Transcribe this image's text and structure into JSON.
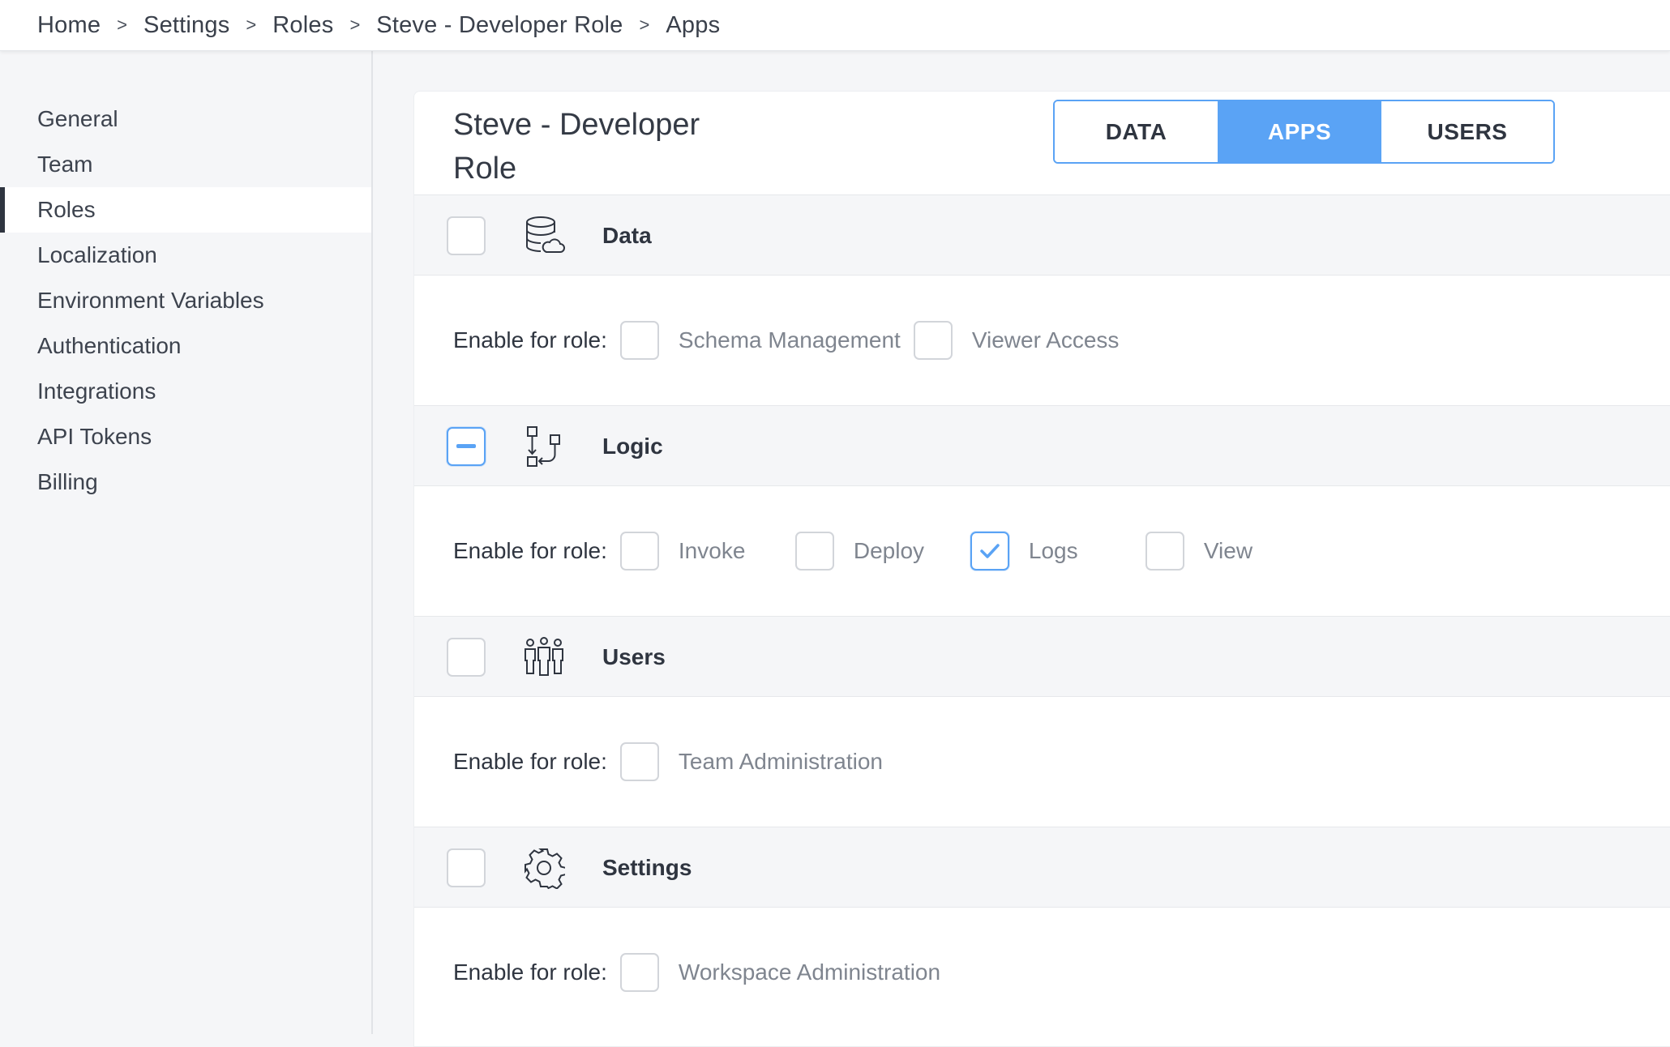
{
  "breadcrumb": [
    "Home",
    "Settings",
    "Roles",
    "Steve - Developer Role",
    "Apps"
  ],
  "breadcrumb_separator": ">",
  "sidebar": {
    "items": [
      {
        "label": "General",
        "active": false
      },
      {
        "label": "Team",
        "active": false
      },
      {
        "label": "Roles",
        "active": true
      },
      {
        "label": "Localization",
        "active": false
      },
      {
        "label": "Environment Variables",
        "active": false
      },
      {
        "label": "Authentication",
        "active": false
      },
      {
        "label": "Integrations",
        "active": false
      },
      {
        "label": "API Tokens",
        "active": false
      },
      {
        "label": "Billing",
        "active": false
      }
    ]
  },
  "role": {
    "title": "Steve - Developer Role"
  },
  "tabs": [
    {
      "label": "DATA",
      "active": false
    },
    {
      "label": "APPS",
      "active": true
    },
    {
      "label": "USERS",
      "active": false
    }
  ],
  "enable_label": "Enable for role:",
  "sections": [
    {
      "title": "Data",
      "icon": "database-cloud-icon",
      "state": "unchecked",
      "options": [
        {
          "label": "Schema Management",
          "checked": false
        },
        {
          "label": "Viewer Access",
          "checked": false
        }
      ]
    },
    {
      "title": "Logic",
      "icon": "logic-flow-icon",
      "state": "indeterminate",
      "options": [
        {
          "label": "Invoke",
          "checked": false
        },
        {
          "label": "Deploy",
          "checked": false
        },
        {
          "label": "Logs",
          "checked": true
        },
        {
          "label": "View",
          "checked": false
        }
      ]
    },
    {
      "title": "Users",
      "icon": "users-group-icon",
      "state": "unchecked",
      "options": [
        {
          "label": "Team Administration",
          "checked": false
        }
      ]
    },
    {
      "title": "Settings",
      "icon": "gear-icon",
      "state": "unchecked",
      "options": [
        {
          "label": "Workspace Administration",
          "checked": false
        }
      ]
    }
  ],
  "colors": {
    "accent": "#5aa3f5",
    "text": "#2f3540",
    "muted": "#7f858f",
    "background": "#f5f6f8"
  }
}
